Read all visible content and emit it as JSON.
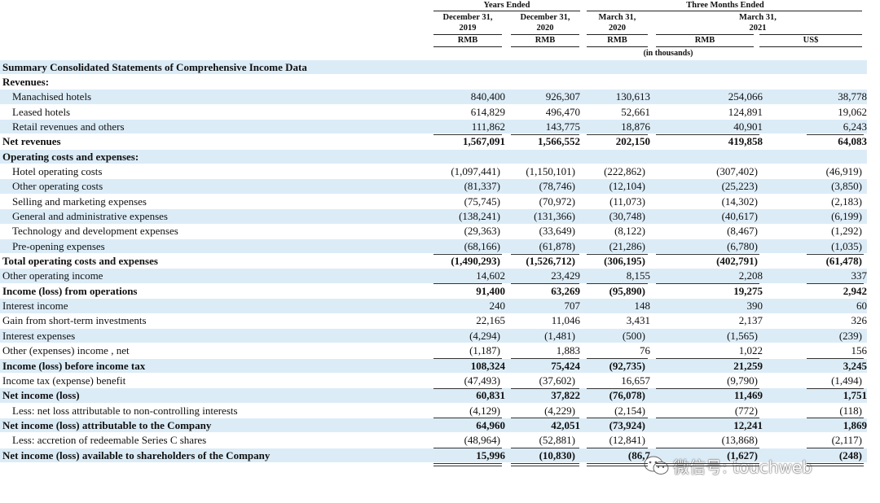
{
  "headers": {
    "years_ended": "Years Ended",
    "three_months_ended": "Three Months Ended",
    "col1_date": [
      "December 31,",
      "2019"
    ],
    "col2_date": [
      "December 31,",
      "2020"
    ],
    "col3_date": [
      "March 31,",
      "2020"
    ],
    "col45_date": [
      "March 31,",
      "2021"
    ],
    "currency": [
      "RMB",
      "RMB",
      "RMB",
      "RMB",
      "US$"
    ],
    "in_thousands": "(in thousands)"
  },
  "rows": [
    {
      "label": "Summary Consolidated Statements of Comprehensive Income Data",
      "bold": true,
      "values": [
        "",
        "",
        "",
        "",
        ""
      ]
    },
    {
      "label": "Revenues:",
      "bold": true,
      "values": [
        "",
        "",
        "",
        "",
        ""
      ]
    },
    {
      "label": "Manachised hotels",
      "indent": true,
      "values": [
        "840,400",
        "926,307",
        "130,613",
        "254,066",
        "38,778"
      ]
    },
    {
      "label": "Leased hotels",
      "indent": true,
      "values": [
        "614,829",
        "496,470",
        "52,661",
        "124,891",
        "19,062"
      ]
    },
    {
      "label": "Retail revenues and others",
      "indent": true,
      "values": [
        "111,862",
        "143,775",
        "18,876",
        "40,901",
        "6,243"
      ]
    },
    {
      "label": "Net revenues",
      "bold": true,
      "values": [
        "1,567,091",
        "1,566,552",
        "202,150",
        "419,858",
        "64,083"
      ]
    },
    {
      "label": "Operating costs and expenses:",
      "bold": true,
      "values": [
        "",
        "",
        "",
        "",
        ""
      ]
    },
    {
      "label": "Hotel operating costs",
      "indent": true,
      "values": [
        "(1,097,441)",
        "(1,150,101)",
        "(222,862)",
        "(307,402)",
        "(46,919)"
      ]
    },
    {
      "label": "Other operating costs",
      "indent": true,
      "values": [
        "(81,337)",
        "(78,746)",
        "(12,104)",
        "(25,223)",
        "(3,850)"
      ]
    },
    {
      "label": "Selling and marketing expenses",
      "indent": true,
      "values": [
        "(75,745)",
        "(70,972)",
        "(11,073)",
        "(14,302)",
        "(2,183)"
      ]
    },
    {
      "label": "General and administrative expenses",
      "indent": true,
      "values": [
        "(138,241)",
        "(131,366)",
        "(30,748)",
        "(40,617)",
        "(6,199)"
      ]
    },
    {
      "label": "Technology and development expenses",
      "indent": true,
      "values": [
        "(29,363)",
        "(33,649)",
        "(8,122)",
        "(8,467)",
        "(1,292)"
      ]
    },
    {
      "label": "Pre-opening expenses",
      "indent": true,
      "values": [
        "(68,166)",
        "(61,878)",
        "(21,286)",
        "(6,780)",
        "(1,035)"
      ]
    },
    {
      "label": "Total operating costs and expenses",
      "bold": true,
      "values": [
        "(1,490,293)",
        "(1,526,712)",
        "(306,195)",
        "(402,791)",
        "(61,478)"
      ]
    },
    {
      "label": "Other operating income",
      "values": [
        "14,602",
        "23,429",
        "8,155",
        "2,208",
        "337"
      ]
    },
    {
      "label": "Income (loss) from operations",
      "bold": true,
      "values": [
        "91,400",
        "63,269",
        "(95,890)",
        "19,275",
        "2,942"
      ]
    },
    {
      "label": "Interest income",
      "values": [
        "240",
        "707",
        "148",
        "390",
        "60"
      ]
    },
    {
      "label": "Gain from short-term investments",
      "values": [
        "22,165",
        "11,046",
        "3,431",
        "2,137",
        "326"
      ]
    },
    {
      "label": "Interest expenses",
      "values": [
        "(4,294)",
        "(1,481)",
        "(500)",
        "(1,565)",
        "(239)"
      ]
    },
    {
      "label": "Other (expenses) income , net",
      "values": [
        "(1,187)",
        "1,883",
        "76",
        "1,022",
        "156"
      ]
    },
    {
      "label": "Income (loss) before income tax",
      "bold": true,
      "values": [
        "108,324",
        "75,424",
        "(92,735)",
        "21,259",
        "3,245"
      ]
    },
    {
      "label": "Income tax (expense) benefit",
      "values": [
        "(47,493)",
        "(37,602)",
        "16,657",
        "(9,790)",
        "(1,494)"
      ]
    },
    {
      "label": "Net income (loss)",
      "bold": true,
      "values": [
        "60,831",
        "37,822",
        "(76,078)",
        "11,469",
        "1,751"
      ]
    },
    {
      "label": "Less: net loss attributable to non-controlling interests",
      "indent": true,
      "values": [
        "(4,129)",
        "(4,229)",
        "(2,154)",
        "(772)",
        "(118)"
      ]
    },
    {
      "label": "Net income (loss) attributable to the Company",
      "bold": true,
      "values": [
        "64,960",
        "42,051",
        "(73,924)",
        "12,241",
        "1,869"
      ]
    },
    {
      "label": "Less: accretion of redeemable Series C shares",
      "indent": true,
      "values": [
        "(48,964)",
        "(52,881)",
        "(12,841)",
        "(13,868)",
        "(2,117)"
      ]
    },
    {
      "label": "Net income (loss) available to shareholders of the Company",
      "bold": true,
      "values": [
        "15,996",
        "(10,830)",
        "(86,7",
        "(1,627)",
        "(248)"
      ]
    }
  ],
  "watermark": "微信号: touchweb",
  "colors": {
    "row_shade": "#dcecf7"
  }
}
